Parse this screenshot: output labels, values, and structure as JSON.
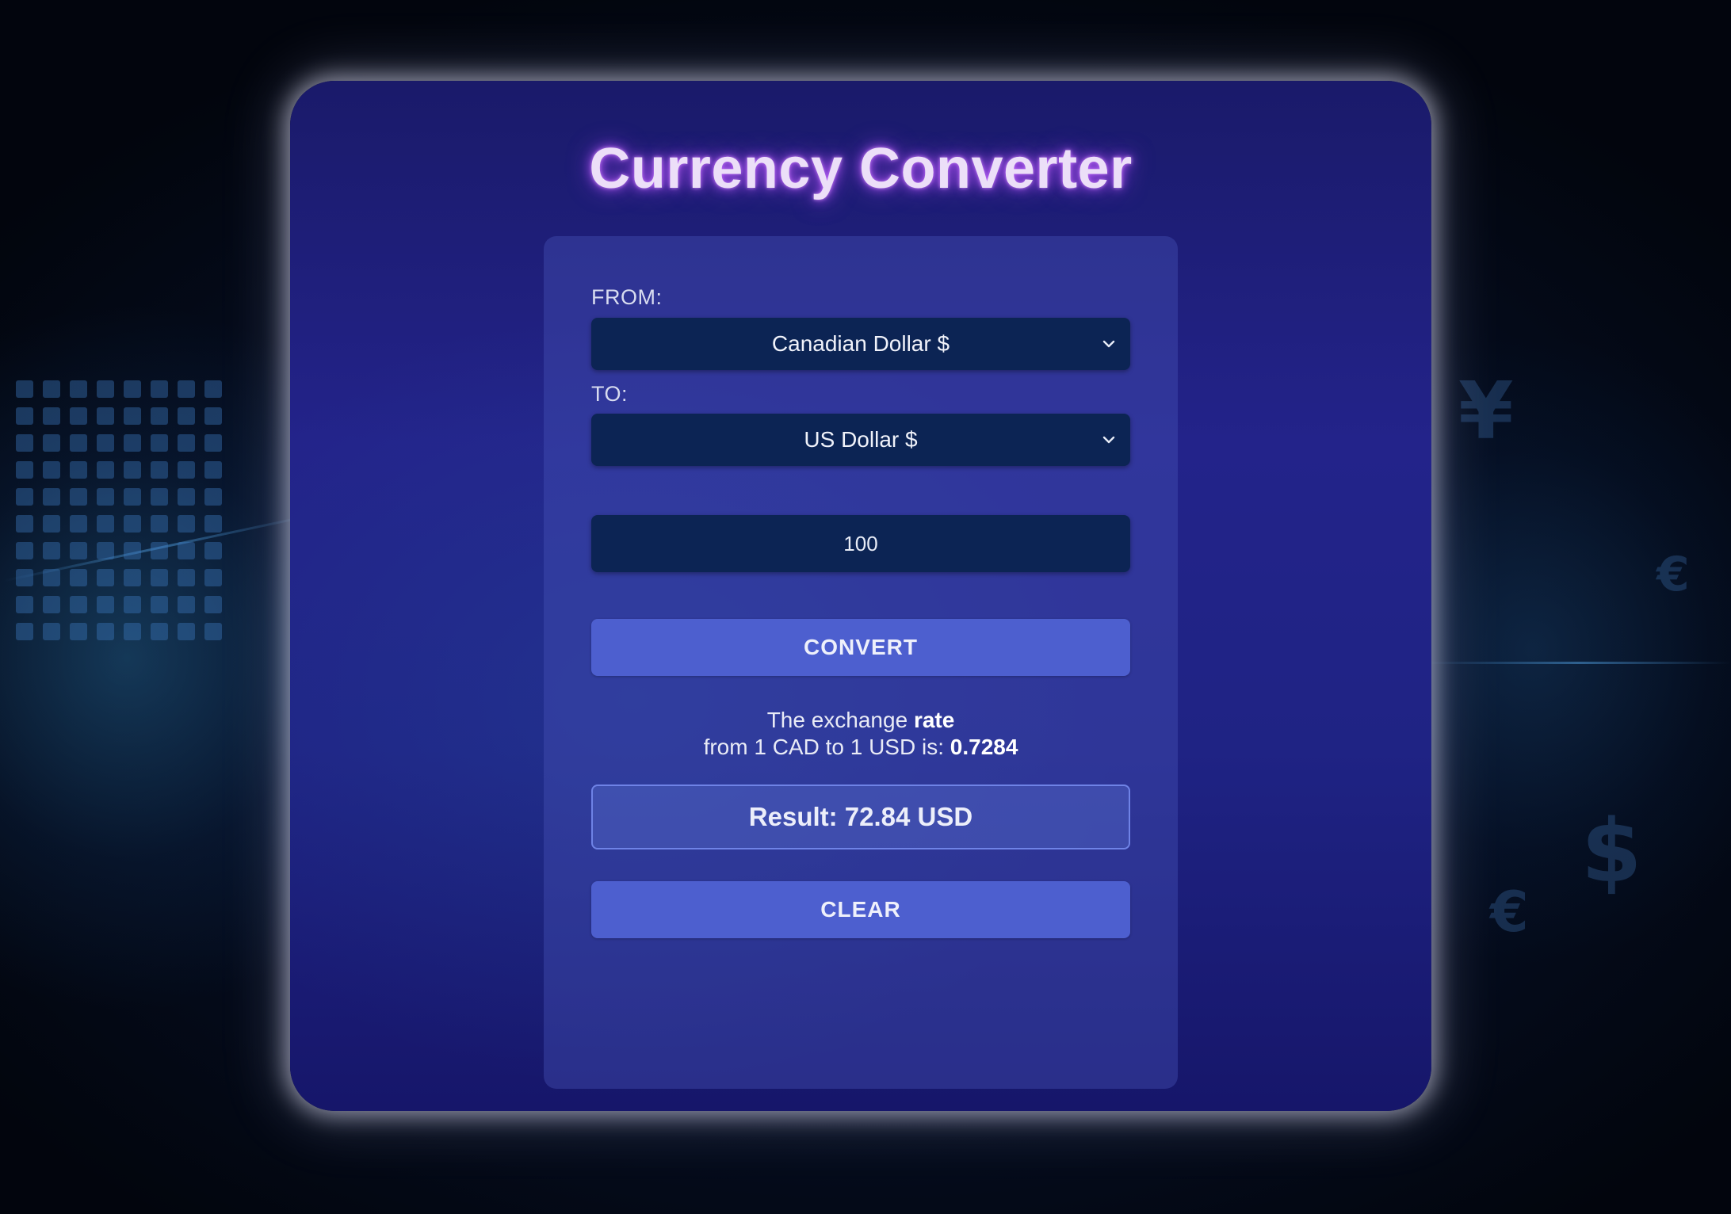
{
  "app": {
    "title": "Currency Converter"
  },
  "form": {
    "from_label": "FROM:",
    "from_value": "Canadian Dollar $",
    "to_label": "TO:",
    "to_value": "US Dollar $",
    "amount_value": "100",
    "convert_label": "CONVERT",
    "rate_line1_prefix": "The exchange ",
    "rate_line1_bold": "rate",
    "rate_line2_prefix": "from 1 CAD to 1 USD is: ",
    "rate_value": "0.7284",
    "result_text": "Result: 72.84 USD",
    "clear_label": "CLEAR"
  },
  "background": {
    "symbols": [
      "¥",
      "€",
      "$",
      "$",
      "€"
    ]
  },
  "colors": {
    "page_background": "#02050d",
    "card_background": "#1f2384",
    "panel_background": "#3a43a8",
    "select_background": "#0c2454",
    "button_background": "#4d5fcf",
    "title_glow": "#b45aff"
  }
}
